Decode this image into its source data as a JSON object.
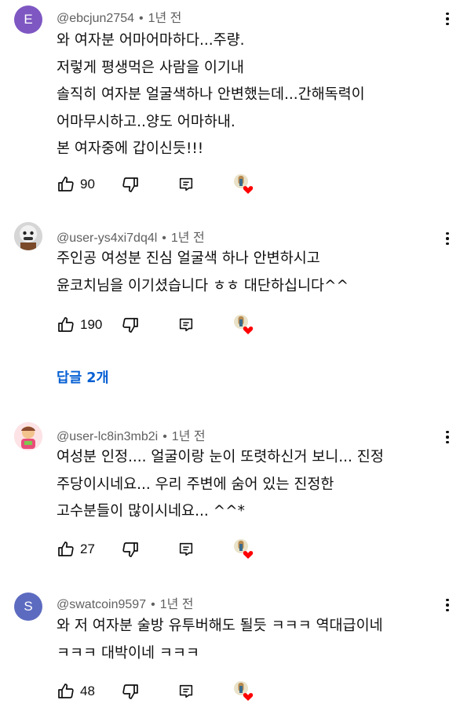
{
  "comments": [
    {
      "avatar_letter": "E",
      "avatar_color": "#7e57c2",
      "username": "@ebcjun2754",
      "time": "1년 전",
      "lines": [
        "와 여자분 어마어마하다...주량.",
        "저렇게 평생먹은 사람을 이기내",
        "솔직히 여자분 얼굴색하나 안변했는데...간해독력이",
        "어마무시하고..양도 어마하내.",
        "본 여자중에 갑이신듯!!!"
      ],
      "likes": "90"
    },
    {
      "avatar_letter": "",
      "avatar_color": "#cfcfcf",
      "username": "@user-ys4xi7dq4l",
      "time": "1년 전",
      "lines": [
        "주인공 여성분 진심 얼굴색 하나 안변하시고",
        "윤코치님을 이기셨습니다 ㅎㅎ 대단하십니다^^"
      ],
      "likes": "190"
    },
    {
      "avatar_letter": "",
      "avatar_color": "#f2c9cf",
      "username": "@user-lc8in3mb2i",
      "time": "1년 전",
      "lines": [
        "여성분 인정.... 얼굴이랑 눈이 또렷하신거 보니... 진정",
        "주당이시네요... 우리 주변에 숨어 있는 진정한",
        "고수분들이 많이시네요... ^^*"
      ],
      "likes": "27"
    },
    {
      "avatar_letter": "S",
      "avatar_color": "#5c6bc0",
      "username": "@swatcoin9597",
      "time": "1년 전",
      "lines": [
        "와 저 여자분 술방 유투버해도 될듯 ㅋㅋㅋ 역대급이네",
        "ㅋㅋㅋ 대박이네 ㅋㅋㅋ"
      ],
      "likes": "48"
    }
  ],
  "replies_label": "답글 2개",
  "icons": [
    "thumbs-up-icon",
    "thumbs-down-icon",
    "reply-icon",
    "creator-heart-icon",
    "more-vert-icon"
  ]
}
